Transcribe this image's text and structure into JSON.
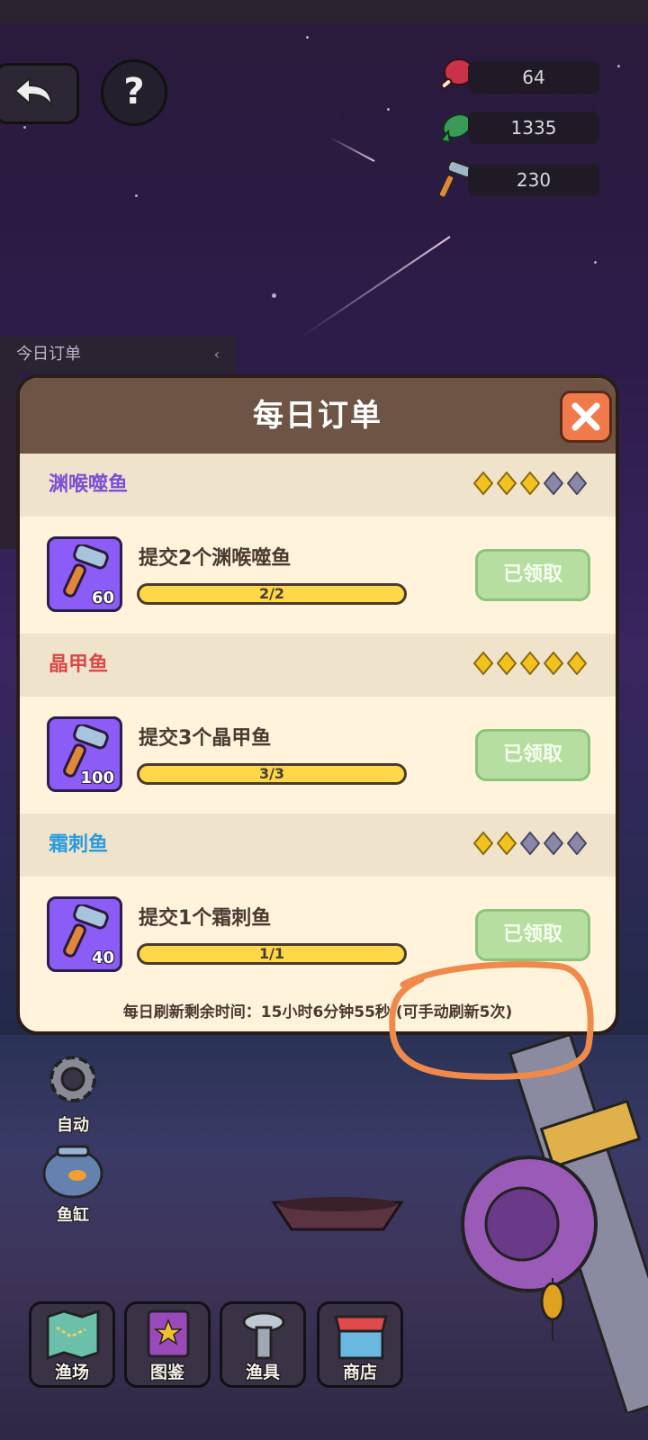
{
  "resources": [
    {
      "icon": "meat-icon",
      "value": "64"
    },
    {
      "icon": "fish-icon",
      "value": "1335"
    },
    {
      "icon": "hammer-icon",
      "value": "230"
    }
  ],
  "side_panel": {
    "title": "今日订单",
    "arrow": "‹"
  },
  "dialog": {
    "title": "每日订单",
    "orders": [
      {
        "name": "渊喉噬鱼",
        "name_color": "#7b4fd6",
        "gems": [
          "gold",
          "gold",
          "gold",
          "gray",
          "gray"
        ],
        "task": "提交2个渊喉噬鱼",
        "progress": "2/2",
        "progress_fraction": 1.0,
        "reward": "60",
        "button": "已领取"
      },
      {
        "name": "晶甲鱼",
        "name_color": "#d94a4a",
        "gems": [
          "gold",
          "gold",
          "gold",
          "gold",
          "gold"
        ],
        "task": "提交3个晶甲鱼",
        "progress": "3/3",
        "progress_fraction": 1.0,
        "reward": "100",
        "button": "已领取"
      },
      {
        "name": "霜刺鱼",
        "name_color": "#2a9be0",
        "gems": [
          "gold",
          "gold",
          "gray",
          "gray",
          "gray"
        ],
        "task": "提交1个霜刺鱼",
        "progress": "1/1",
        "progress_fraction": 1.0,
        "reward": "40",
        "button": "已领取"
      }
    ],
    "refresh_text": "每日刷新剩余时间：15小时6分钟55秒 (可手动刷新5次)"
  },
  "side_buttons": [
    {
      "label": "自动",
      "icon": "gear-icon"
    },
    {
      "label": "鱼缸",
      "icon": "fishbowl-icon"
    }
  ],
  "nav": [
    {
      "label": "渔场",
      "icon": "map-icon"
    },
    {
      "label": "图鉴",
      "icon": "book-icon"
    },
    {
      "label": "渔具",
      "icon": "screw-icon"
    },
    {
      "label": "商店",
      "icon": "shop-icon"
    }
  ],
  "colors": {
    "dialog_bg": "#fff3dc",
    "header": "#6d5444",
    "close": "#f07a4a",
    "claimed": "#b6dea0",
    "progress": "#ffd84a",
    "annotation": "#f08a4a"
  }
}
